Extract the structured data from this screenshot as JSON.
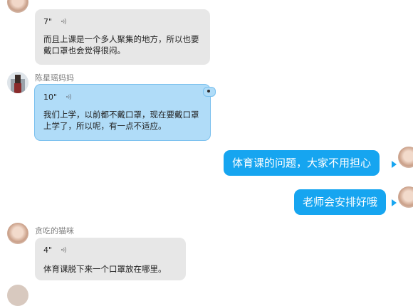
{
  "messages": [
    {
      "sender": "贪吃的猫咪",
      "duration": "7\"",
      "text": "而且上课是一个多人聚集的地方，所以也要戴口罩也会觉得很闷。"
    },
    {
      "sender": "陈星瑶妈妈",
      "duration": "10\"",
      "text": "我们上学，以前都不戴口罩，现在要戴口罩上学了，所以呢，有一点不适应。"
    },
    {
      "sender": "me",
      "text": "体育课的问题，大家不用担心"
    },
    {
      "sender": "me",
      "text": "老师会安排好哦"
    },
    {
      "sender": "贪吃的猫咪",
      "duration": "4\"",
      "text": "体育课脱下来一个口罩放在哪里。"
    }
  ],
  "icons": {
    "voice": "voice-wave-icon"
  },
  "colors": {
    "outgoing_bubble": "#16a5f0",
    "incoming_bubble": "#e7e7e7",
    "highlighted_bubble": "#b0dcf8"
  }
}
